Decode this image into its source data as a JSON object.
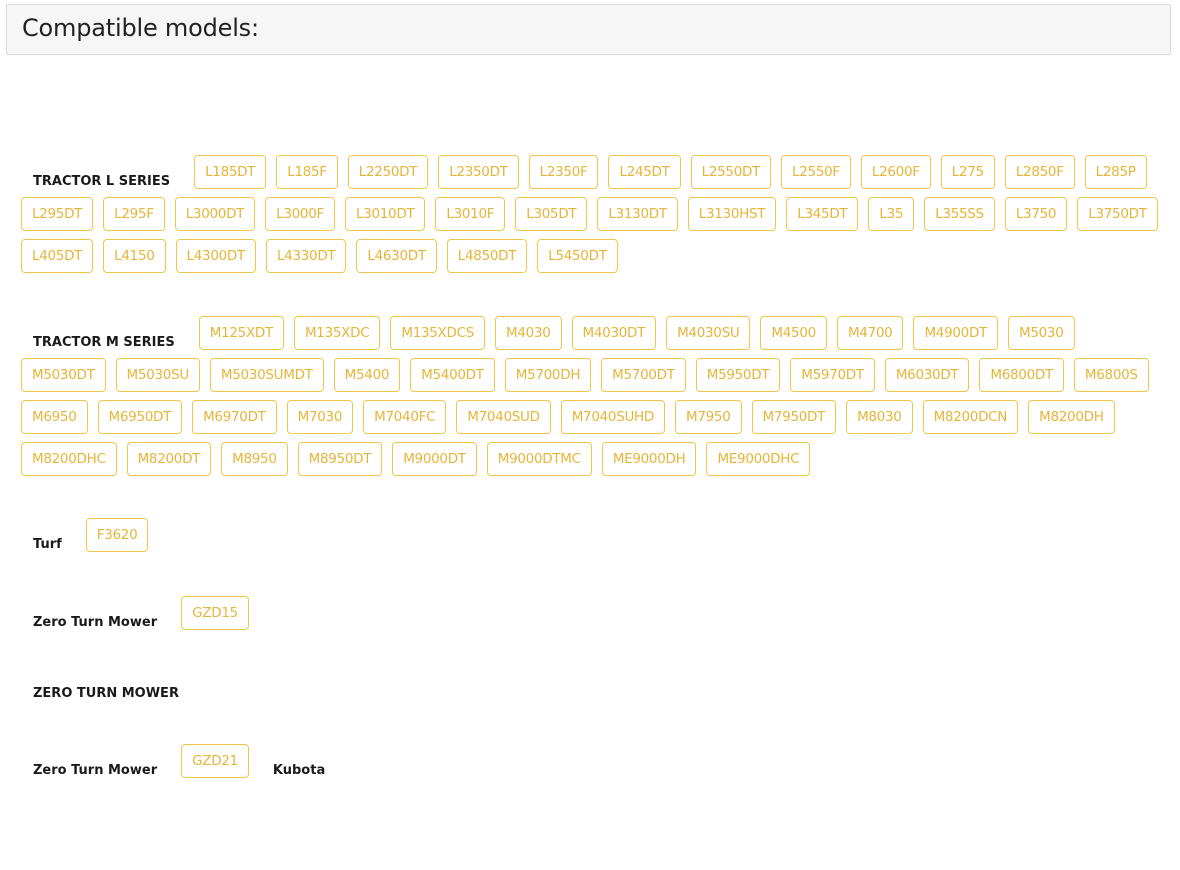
{
  "header": {
    "title": "Compatible models:"
  },
  "groups": {
    "tractor_l": {
      "label": "TRACTOR L SERIES",
      "models": [
        "L185DT",
        "L185F",
        "L2250DT",
        "L2350DT",
        "L2350F",
        "L245DT",
        "L2550DT",
        "L2550F",
        "L2600F",
        "L275",
        "L2850F",
        "L285P",
        "L295DT",
        "L295F",
        "L3000DT",
        "L3000F",
        "L3010DT",
        "L3010F",
        "L305DT",
        "L3130DT",
        "L3130HST",
        "L345DT",
        "L35",
        "L355SS",
        "L3750",
        "L3750DT",
        "L405DT",
        "L4150",
        "L4300DT",
        "L4330DT",
        "L4630DT",
        "L4850DT",
        "L5450DT"
      ]
    },
    "tractor_m": {
      "label": "TRACTOR M SERIES",
      "models": [
        "M125XDT",
        "M135XDC",
        "M135XDCS",
        "M4030",
        "M4030DT",
        "M4030SU",
        "M4500",
        "M4700",
        "M4900DT",
        "M5030",
        "M5030DT",
        "M5030SU",
        "M5030SUMDT",
        "M5400",
        "M5400DT",
        "M5700DH",
        "M5700DT",
        "M5950DT",
        "M5970DT",
        "M6030DT",
        "M6800DT",
        "M6800S",
        "M6950",
        "M6950DT",
        "M6970DT",
        "M7030",
        "M7040FC",
        "M7040SUD",
        "M7040SUHD",
        "M7950",
        "M7950DT",
        "M8030",
        "M8200DCN",
        "M8200DH",
        "M8200DHC",
        "M8200DT",
        "M8950",
        "M8950DT",
        "M9000DT",
        "M9000DTMC",
        "ME9000DH",
        "ME9000DHC"
      ]
    },
    "turf": {
      "label": "Turf",
      "models": [
        "F3620"
      ]
    },
    "zero_turn_1": {
      "label": "Zero Turn Mower",
      "models": [
        "GZD15"
      ]
    },
    "zero_turn_upper": {
      "label": "ZERO TURN MOWER"
    },
    "zero_turn_2": {
      "label": "Zero Turn Mower",
      "models": [
        "GZD21"
      ],
      "brand": "Kubota"
    }
  },
  "colors": {
    "chip_border": "#f0c64a",
    "chip_text": "#e5b53a",
    "header_bg": "#f6f6f6"
  }
}
